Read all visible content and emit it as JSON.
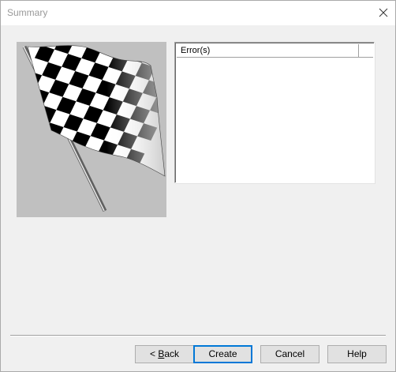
{
  "window": {
    "title": "Summary"
  },
  "errors_list": {
    "columns": [
      "Error(s)",
      ""
    ],
    "rows": []
  },
  "buttons": {
    "back_mnemonic_prefix": "< ",
    "back_mnemonic_char": "B",
    "back_rest": "ack",
    "create": "Create",
    "cancel": "Cancel",
    "help": "Help"
  },
  "icons": {
    "close": "close-icon",
    "flag": "checkered-flag-illustration"
  },
  "colors": {
    "dialog_background": "#f0f0f0",
    "title_text": "#999999",
    "flag_panel": "#c0c0c0",
    "default_button_border": "#0078d7"
  }
}
